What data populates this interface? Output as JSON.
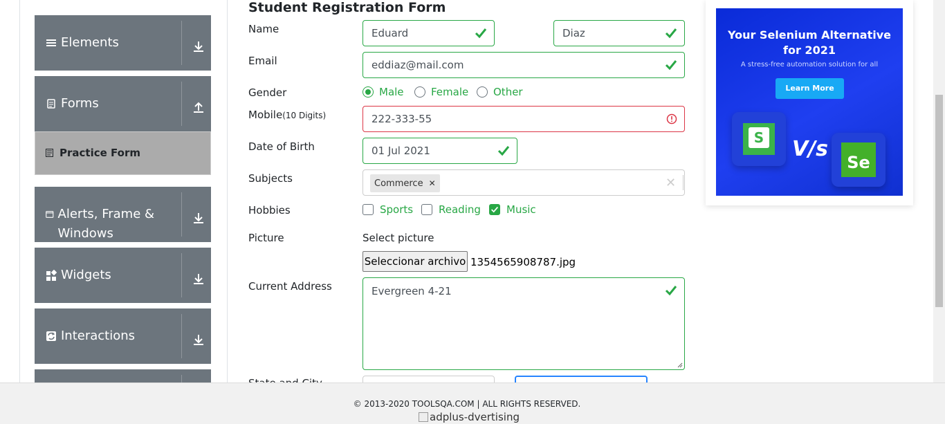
{
  "sidebar": {
    "groups": [
      {
        "label": "Elements",
        "icon": "menu-bars-icon",
        "arrow": "download-arrow-icon"
      },
      {
        "label": "Forms",
        "icon": "document-icon",
        "arrow": "upload-arrow-icon"
      },
      {
        "label": "Alerts, Frame & Windows",
        "icon": "window-icon",
        "arrow": "download-arrow-icon"
      },
      {
        "label": "Widgets",
        "icon": "widgets-icon",
        "arrow": "download-arrow-icon"
      },
      {
        "label": "Interactions",
        "icon": "interactions-icon",
        "arrow": "download-arrow-icon"
      }
    ],
    "active_item": "Practice Form"
  },
  "form": {
    "title": "Student Registration Form",
    "name_label": "Name",
    "first_name": "Eduard",
    "last_name": "Diaz",
    "email_label": "Email",
    "email": "eddiaz@mail.com",
    "gender_label": "Gender",
    "gender_options": [
      "Male",
      "Female",
      "Other"
    ],
    "gender_selected": "Male",
    "mobile_label": "Mobile",
    "mobile_hint": "(10 Digits)",
    "mobile": "222-333-55",
    "dob_label": "Date of Birth",
    "dob": "01 Jul 2021",
    "subjects_label": "Subjects",
    "subject_chip": "Commerce",
    "hobbies_label": "Hobbies",
    "hobbies": [
      "Sports",
      "Reading",
      "Music"
    ],
    "hobbies_checked": [
      "Music"
    ],
    "picture_label": "Picture",
    "select_picture": "Select picture",
    "file_button": "Seleccionar archivo",
    "file_name": "1354565908787.jpg",
    "address_label": "Current Address",
    "address": "Evergreen 4-21",
    "state_city_label": "State and City"
  },
  "ad": {
    "headline_1": "Your Selenium Alternative",
    "headline_2": "for 2021",
    "subline": "A stress-free automation solution for all",
    "cta": "Learn More",
    "vs": "V/s",
    "left_logo": "S",
    "right_logo": "Se"
  },
  "footer": {
    "copyright": "© 2013-2020 TOOLSQA.COM | ALL RIGHTS RESERVED.",
    "broken_image_alt": "adplus-dvertising"
  },
  "colors": {
    "valid": "#28a745",
    "invalid": "#dc3545",
    "sidebar": "#6c757d",
    "ad_blue": "#1f3ff0"
  }
}
